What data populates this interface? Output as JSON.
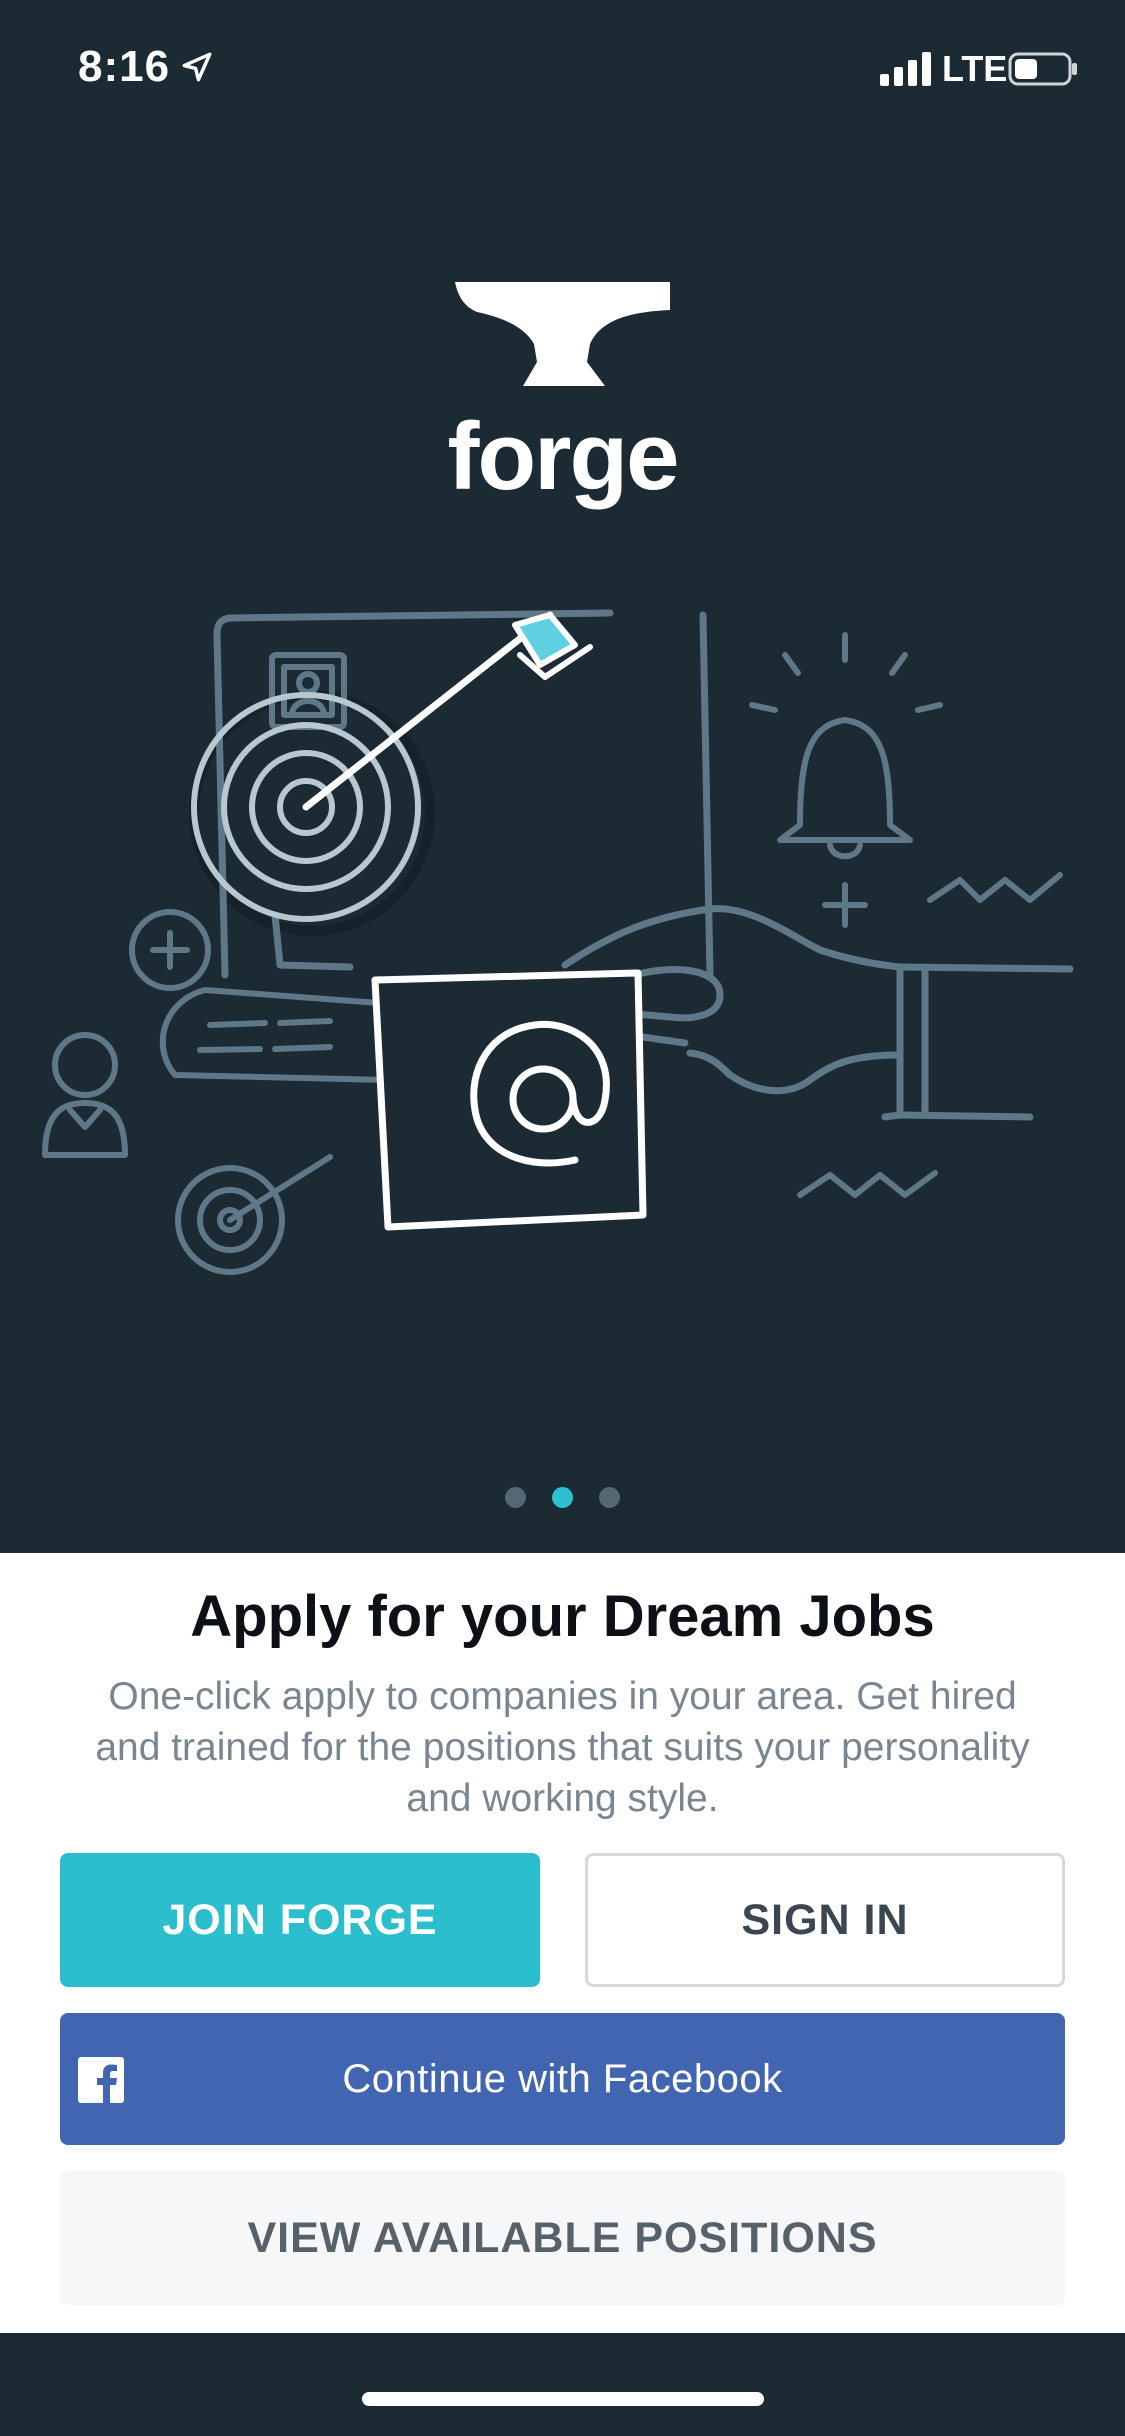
{
  "status_bar": {
    "time": "8:16",
    "network": "LTE",
    "icons": [
      "location-arrow-icon",
      "cellular-signal-icon",
      "battery-icon"
    ]
  },
  "brand": {
    "name": "forge",
    "logo_icon": "anvil-icon"
  },
  "illustration": {
    "icons": [
      "target-arrow-icon",
      "profile-card-icon",
      "bell-icon",
      "plus-icon",
      "person-icon",
      "email-at-icon",
      "hand-icon",
      "keyboard-icon"
    ]
  },
  "carousel": {
    "total_pages": 3,
    "active_page": 2
  },
  "onboarding": {
    "title": "Apply for your Dream Jobs",
    "description": "One-click apply to companies in your area. Get hired and trained for the positions that suits your personality and working style."
  },
  "actions": {
    "join_label": "JOIN FORGE",
    "signin_label": "SIGN IN",
    "facebook_label": "Continue with Facebook",
    "view_positions_label": "VIEW AVAILABLE POSITIONS"
  },
  "colors": {
    "background": "#1c2a33",
    "accent": "#2bc1d0",
    "facebook": "#4265b2",
    "illustration_line": "#5f7888",
    "arrow_fletching": "#5fd0e0"
  }
}
